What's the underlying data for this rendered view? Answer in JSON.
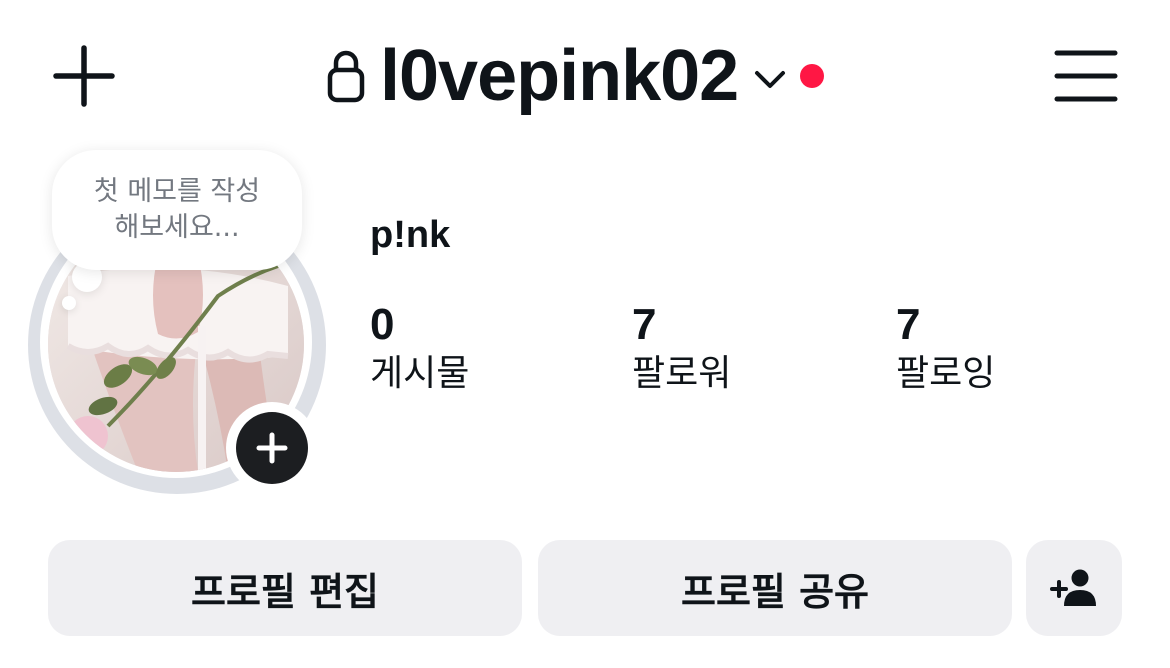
{
  "header": {
    "username": "l0vepink02",
    "has_notification": true,
    "accent_notification": "#ff1744",
    "icons": {
      "create": "plus-icon",
      "lock": "lock-icon",
      "switch_account": "chevron-down-icon",
      "menu": "hamburger-menu-icon"
    }
  },
  "note": {
    "text": "첫 메모를 작성\n해보세요..."
  },
  "profile": {
    "display_name": "p!nk",
    "avatar": "profile-photo",
    "add_story_icon": "plus-icon"
  },
  "stats": [
    {
      "value": "0",
      "label": "게시물"
    },
    {
      "value": "7",
      "label": "팔로워"
    },
    {
      "value": "7",
      "label": "팔로잉"
    }
  ],
  "actions": {
    "edit_profile": "프로필 편집",
    "share_profile": "프로필 공유",
    "add_friend_icon": "add-person-icon"
  }
}
